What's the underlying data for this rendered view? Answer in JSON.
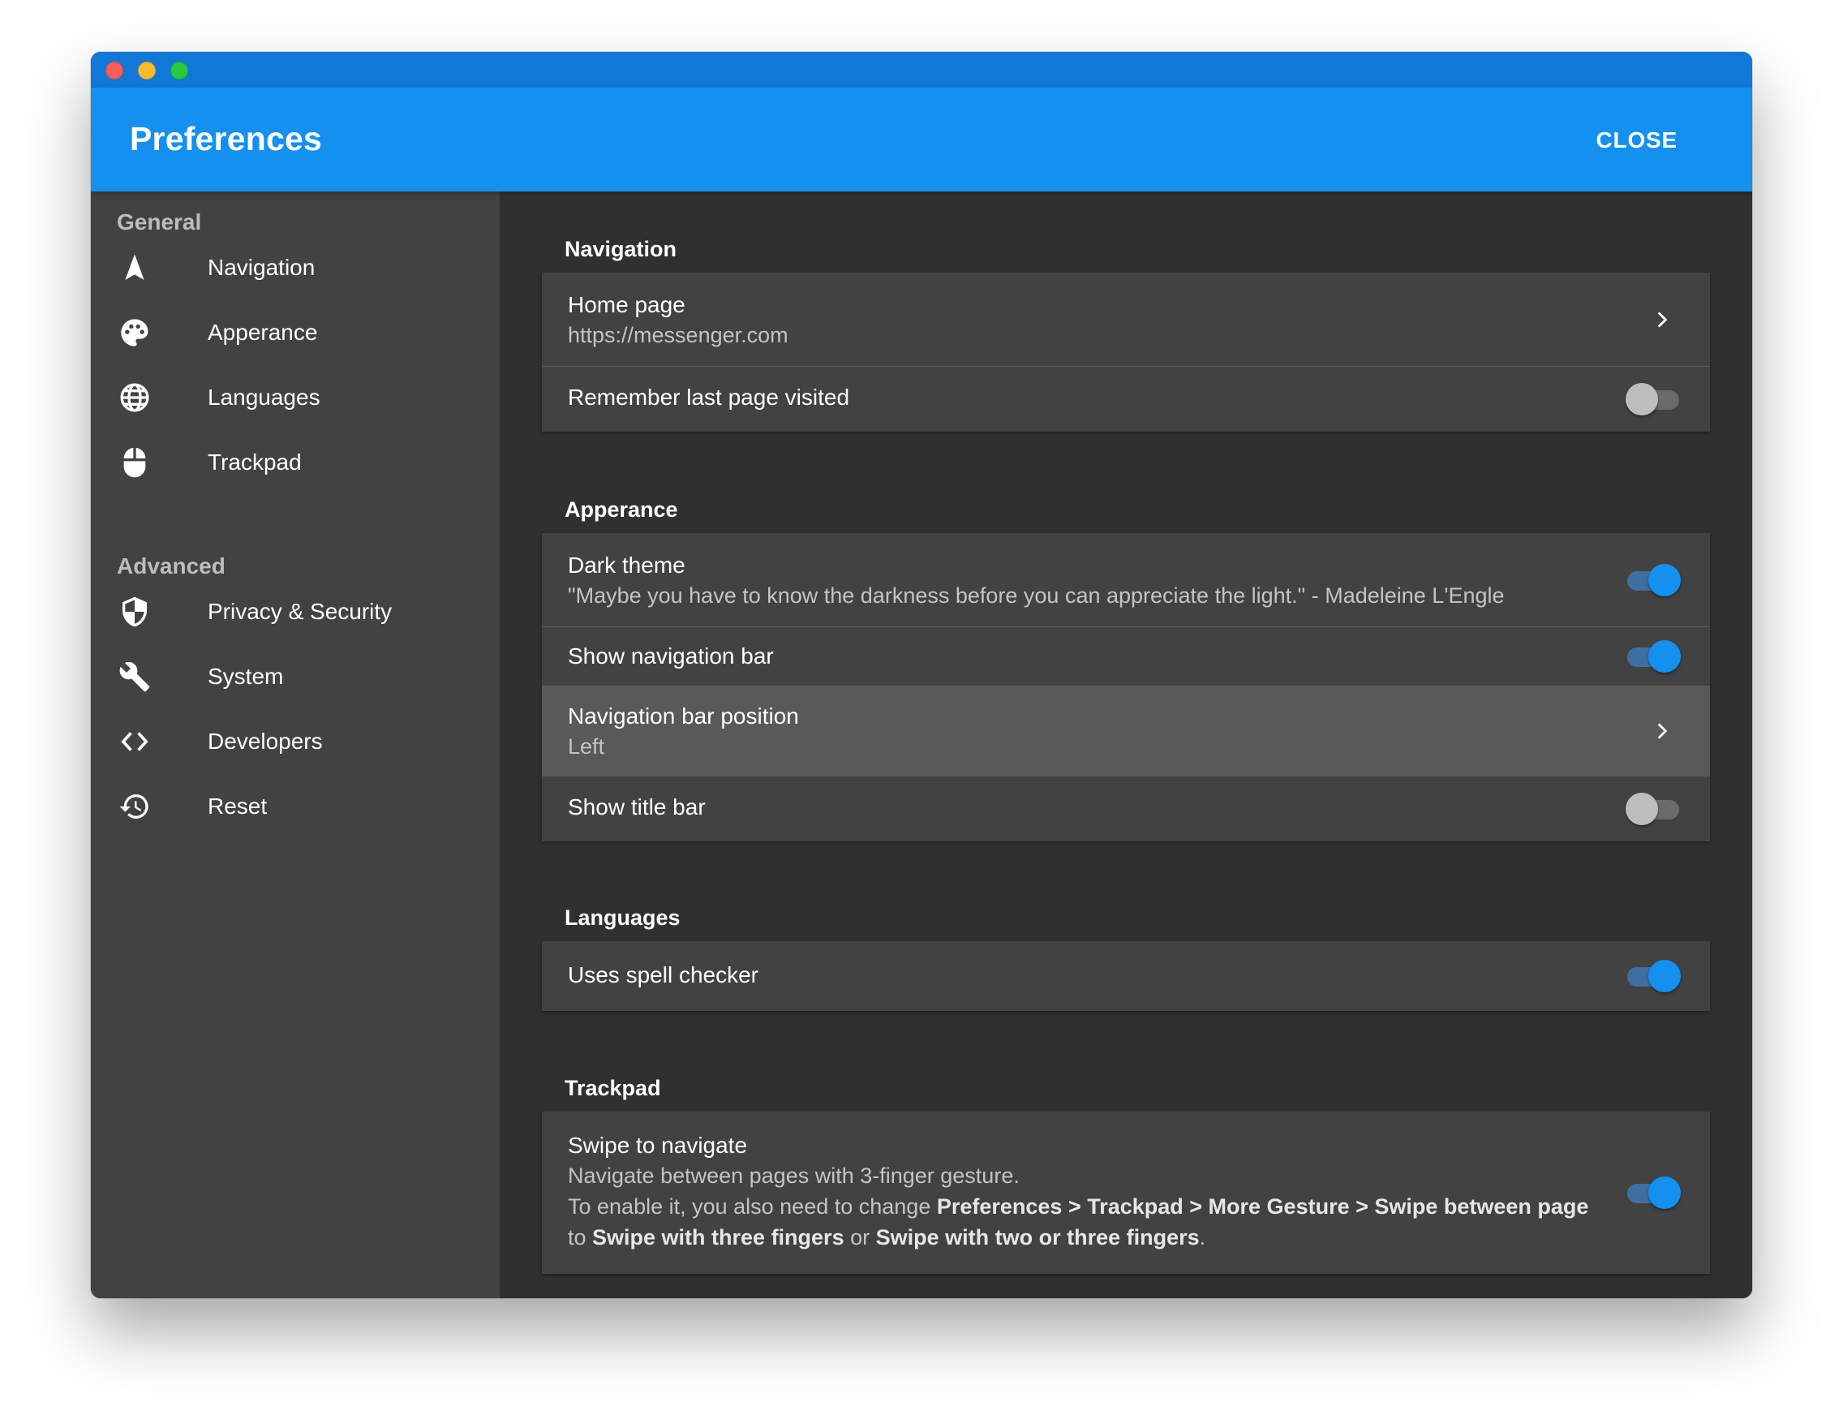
{
  "window": {
    "title": "Preferences",
    "close_label": "CLOSE"
  },
  "sidebar": {
    "general_heading": "General",
    "advanced_heading": "Advanced",
    "general_items": [
      {
        "label": "Navigation",
        "icon": "navigation-arrow-icon"
      },
      {
        "label": "Apperance",
        "icon": "palette-icon"
      },
      {
        "label": "Languages",
        "icon": "globe-icon"
      },
      {
        "label": "Trackpad",
        "icon": "mouse-icon"
      }
    ],
    "advanced_items": [
      {
        "label": "Privacy & Security",
        "icon": "shield-icon"
      },
      {
        "label": "System",
        "icon": "wrench-icon"
      },
      {
        "label": "Developers",
        "icon": "code-icon"
      },
      {
        "label": "Reset",
        "icon": "history-icon"
      }
    ]
  },
  "sections": {
    "navigation": {
      "title": "Navigation",
      "home_page_label": "Home page",
      "home_page_value": "https://messenger.com",
      "remember_last_page_label": "Remember last page visited",
      "remember_last_page_enabled": false
    },
    "appearance": {
      "title": "Apperance",
      "dark_theme_label": "Dark theme",
      "dark_theme_quote": "\"Maybe you have to know the darkness before you can appreciate the light.\" - Madeleine L'Engle",
      "dark_theme_enabled": true,
      "show_nav_bar_label": "Show navigation bar",
      "show_nav_bar_enabled": true,
      "nav_bar_position_label": "Navigation bar position",
      "nav_bar_position_value": "Left",
      "show_title_bar_label": "Show title bar",
      "show_title_bar_enabled": false
    },
    "languages": {
      "title": "Languages",
      "spell_checker_label": "Uses spell checker",
      "spell_checker_enabled": true
    },
    "trackpad": {
      "title": "Trackpad",
      "swipe_label": "Swipe to navigate",
      "swipe_desc_line1": "Navigate between pages with 3-finger gesture.",
      "swipe_desc_line2_prefix": "To enable it, you also need to change ",
      "swipe_desc_line2_path": "Preferences > Trackpad > More Gesture > Swipe between page",
      "swipe_desc_line3_prefix": "to ",
      "swipe_desc_option1": "Swipe with three fingers",
      "swipe_desc_or": " or ",
      "swipe_desc_option2": "Swipe with two or three fingers",
      "swipe_desc_end": ".",
      "swipe_enabled": true
    }
  },
  "colors": {
    "accent": "#1490f1",
    "titlebar": "#0f78d8",
    "sidebar_bg": "#424242",
    "content_bg": "#303030",
    "card_bg": "#424242"
  }
}
